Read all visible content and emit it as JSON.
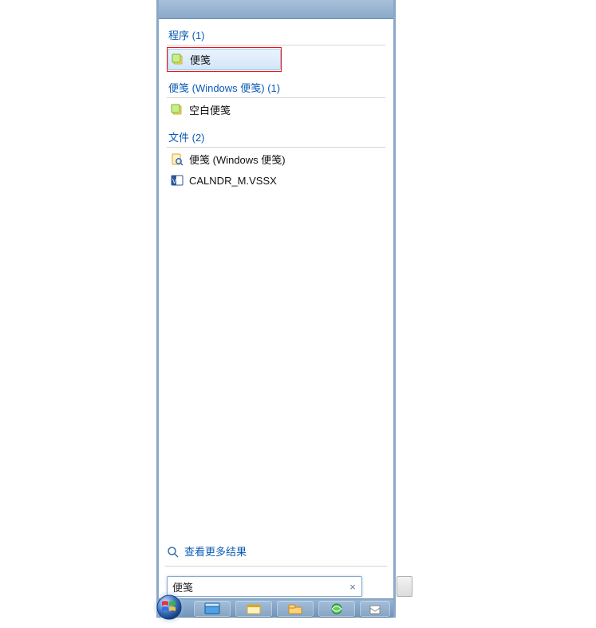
{
  "groups": {
    "programs": {
      "header": "程序 (1)",
      "items": [
        {
          "label": "便笺",
          "icon": "sticky"
        }
      ]
    },
    "sticky": {
      "header": "便笺 (Windows 便笺) (1)",
      "items": [
        {
          "label": "空白便笺",
          "icon": "sticky"
        }
      ]
    },
    "files": {
      "header": "文件 (2)",
      "items": [
        {
          "label": "便笺 (Windows 便笺)",
          "icon": "search-doc"
        },
        {
          "label": "CALNDR_M.VSSX",
          "icon": "visio"
        }
      ]
    }
  },
  "more_results": "查看更多结果",
  "search": {
    "value": "便笺",
    "clear": "×"
  }
}
